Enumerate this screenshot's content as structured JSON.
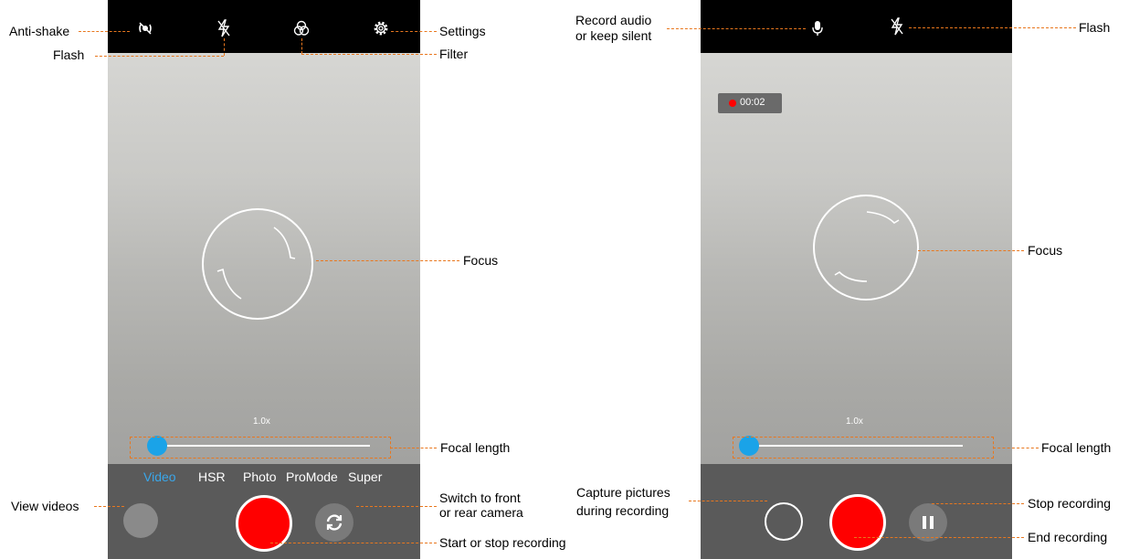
{
  "left_screen": {
    "zoom_level": "1.0x",
    "modes": [
      "Video",
      "HSR",
      "Photo",
      "ProMode",
      "Super"
    ],
    "active_mode": "Video",
    "icons": {
      "anti_shake": "anti-shake-icon",
      "flash": "flash-off-icon",
      "filter": "filter-icon",
      "settings": "settings-gear-icon",
      "switch_camera": "switch-camera-icon"
    }
  },
  "right_screen": {
    "zoom_level": "1.0x",
    "timer": "00:02",
    "icons": {
      "audio": "microphone-icon",
      "flash": "flash-off-icon",
      "pause": "pause-icon"
    }
  },
  "labels": {
    "anti_shake": "Anti-shake",
    "flash_left": "Flash",
    "filter": "Filter",
    "settings": "Settings",
    "focus_left": "Focus",
    "focal_length_left": "Focal length",
    "view_videos": "View videos",
    "switch_camera_1": "Switch to front",
    "switch_camera_2": "or rear camera",
    "start_stop": "Start or stop recording",
    "record_audio_1": "Record audio",
    "record_audio_2": "or keep silent",
    "flash_right": "Flash",
    "focus_right": "Focus",
    "focal_length_right": "Focal length",
    "capture_1": "Capture pictures",
    "capture_2": "during recording",
    "stop_recording": "Stop recording",
    "end_recording": "End recording"
  },
  "colors": {
    "accent_blue": "#1aa3e8",
    "record_red": "#ff0000",
    "leader_orange": "#e8771e"
  }
}
